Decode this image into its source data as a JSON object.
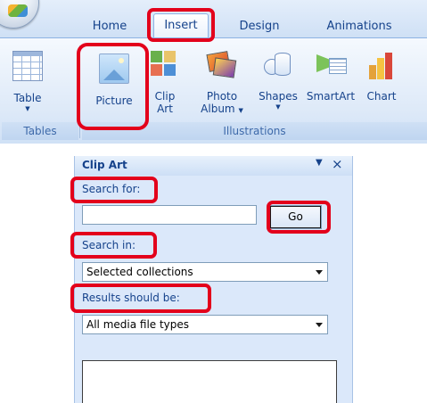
{
  "ribbon": {
    "tabs": [
      {
        "label": "Home"
      },
      {
        "label": "Insert"
      },
      {
        "label": "Design"
      },
      {
        "label": "Animations"
      }
    ],
    "groups": {
      "tables": {
        "label": "Tables",
        "buttons": {
          "table": {
            "label": "Table",
            "icon": "table-icon"
          }
        }
      },
      "illustrations": {
        "label": "Illustrations",
        "buttons": {
          "picture": {
            "label": "Picture",
            "icon": "picture-icon"
          },
          "clipart": {
            "label_line1": "Clip",
            "label_line2": "Art",
            "icon": "clip-art-icon"
          },
          "photo_album": {
            "label_line1": "Photo",
            "label_line2": "Album",
            "icon": "photo-album-icon"
          },
          "shapes": {
            "label": "Shapes",
            "icon": "shapes-icon"
          },
          "smartart": {
            "label": "SmartArt",
            "icon": "smartart-icon"
          },
          "chart": {
            "label": "Chart",
            "icon": "chart-icon"
          }
        }
      }
    }
  },
  "clipart_pane": {
    "title": "Clip Art",
    "search_for_label": "Search for:",
    "search_value": "",
    "go_label": "Go",
    "search_in_label": "Search in:",
    "search_in_value": "Selected collections",
    "results_label": "Results should be:",
    "results_value": "All media file types"
  },
  "colors": {
    "highlight": "#e3001b",
    "ribbon_text": "#15428b"
  }
}
